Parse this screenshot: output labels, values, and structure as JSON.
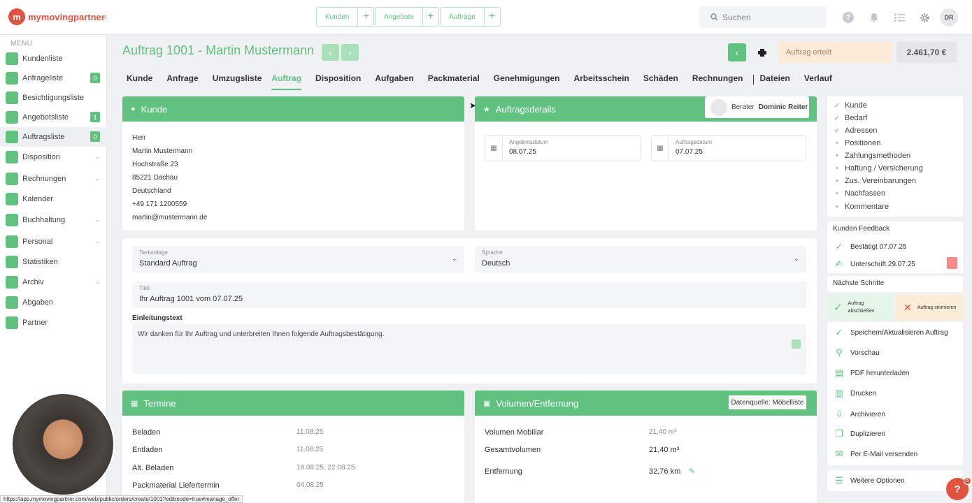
{
  "app": {
    "brand": "mymovingpartner",
    "accent": "#5fc37f",
    "brand_color": "#e2533f"
  },
  "topbar": {
    "collapse_icon": "double-chevron-left",
    "quick": [
      {
        "label": "Kunden",
        "plus": "+"
      },
      {
        "label": "Angebote",
        "plus": "+"
      },
      {
        "label": "Aufträge",
        "plus": "+"
      }
    ],
    "search_placeholder": "Suchen",
    "avatar": "DR"
  },
  "sidebar": {
    "menu_label": "MENU",
    "items": [
      {
        "label": "Kundenliste"
      },
      {
        "label": "Anfrageliste",
        "badge": "0"
      },
      {
        "label": "Besichtigungsliste"
      },
      {
        "label": "Angebotsliste",
        "badge": "1"
      },
      {
        "label": "Auftragsliste",
        "badge": "0",
        "active": true
      },
      {
        "label": "Disposition",
        "chevron": true
      },
      {
        "label": "Rechnungen",
        "chevron": true
      },
      {
        "label": "Kalender"
      },
      {
        "label": "Buchhaltung",
        "chevron": true
      },
      {
        "label": "Personal",
        "chevron": true
      },
      {
        "label": "Statistiken"
      },
      {
        "label": "Archiv",
        "chevron": true
      },
      {
        "label": "Abgaben"
      },
      {
        "label": "Partner"
      }
    ]
  },
  "header": {
    "title": "Auftrag 1001 - Martin Mustermann",
    "status": "Auftrag erteilt",
    "amount": "2.461,70 €"
  },
  "tabs": [
    "Kunde",
    "Anfrage",
    "Umzugsliste",
    "Auftrag",
    "Disposition",
    "Aufgaben",
    "Packmaterial",
    "Genehmigungen",
    "Arbeitsschein",
    "Schäden",
    "Rechnungen",
    "Dateien",
    "Verlauf"
  ],
  "kunde": {
    "title": "Kunde",
    "lines": [
      "Herr",
      "Martin Mustermann",
      "Hochstraße 23",
      "85221 Dachau",
      "Deutschland",
      "+49 171 1200559",
      "martin@mustermann.de"
    ]
  },
  "auftragsdetails": {
    "title": "Auftragsdetails",
    "berater_label": "Berater",
    "berater_name": "Dominic Reiter",
    "angebotsdatum_label": "Angebotsdatum",
    "angebotsdatum": "08.07.25",
    "auftragsdatum_label": "Auftragsdatum",
    "auftragsdatum": "07.07.25"
  },
  "form": {
    "textvorlage_label": "Textvorlage",
    "textvorlage": "Standard Auftrag",
    "sprache_label": "Sprache",
    "sprache": "Deutsch",
    "titel_label": "Titel",
    "titel": "Ihr Auftrag 1001 vom 07.07.25",
    "einleitung_label": "Einleitungstext",
    "einleitung": "Wir danken für Ihr Auftrag und unterbreiten Ihnen folgende Auftragsbestätigung."
  },
  "termine": {
    "title": "Termine",
    "rows": [
      {
        "label": "Beladen",
        "value": "11.08.25"
      },
      {
        "label": "Entladen",
        "value": "11.08.25"
      },
      {
        "label": "Alt. Beladen",
        "value": "19.08.25, 22.08.25"
      },
      {
        "label": "Packmaterial Liefertermin",
        "value": "04.08.25"
      }
    ]
  },
  "volumen": {
    "title": "Volumen/Entfernung",
    "source": "Datenquelle: Möbelliste",
    "rows": [
      {
        "label": "Volumen Mobiliar",
        "value": "21,40 m³"
      },
      {
        "label": "Gesamtvolumen",
        "value": "21,40 m³"
      },
      {
        "label": "Entfernung",
        "value": "32,76 km"
      }
    ]
  },
  "right": {
    "checklist": [
      {
        "label": "Kunde",
        "done": true
      },
      {
        "label": "Bedarf",
        "done": true
      },
      {
        "label": "Adressen",
        "done": true
      },
      {
        "label": "Positionen",
        "done": false
      },
      {
        "label": "Zahlungsmethoden",
        "done": false
      },
      {
        "label": "Haftung / Versicherung",
        "done": false
      },
      {
        "label": "Zus. Vereinbarungen",
        "done": false
      },
      {
        "label": "Nachfassen",
        "done": false
      },
      {
        "label": "Kommentare",
        "done": false
      }
    ],
    "feedback_title": "Kunden Feedback",
    "feedback": [
      "Bestätigt 07.07.25",
      "Unterschrift 29.07.25"
    ],
    "next_title": "Nächste Schritte",
    "next_ok_line1": "Auftrag",
    "next_ok_line2": "abschließen",
    "next_cancel": "Auftrag stornieren",
    "actions": [
      "Speichern/Aktualisieren Auftrag",
      "Vorschau",
      "PDF herunterladen",
      "Drucken",
      "Archivieren",
      "Duplizieren",
      "Per E-Mail versenden"
    ],
    "more": "Weitere Optionen"
  },
  "statusbar_url": "https://app.mymovingpartner.com/web/public/orders/create/1001?editmode=true#manage_offer",
  "fab": {
    "label": "?",
    "badge": "5"
  }
}
